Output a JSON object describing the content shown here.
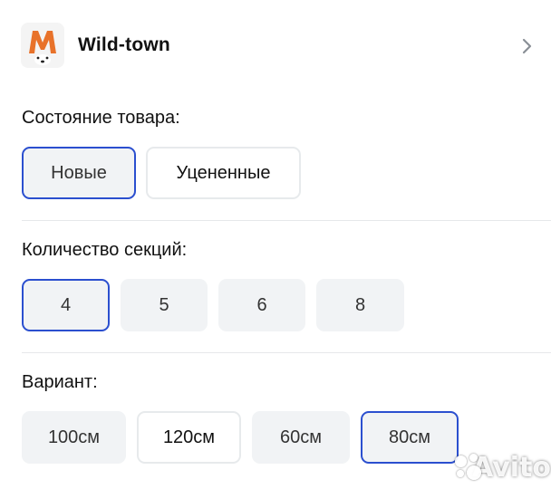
{
  "seller": {
    "logo_letter": "M",
    "name": "Wild-town",
    "logo_icon": "shop-logo-icon",
    "chevron_icon": "chevron-right-icon",
    "accent": "#e8722a"
  },
  "condition": {
    "title": "Состояние товара:",
    "options": [
      "Новые",
      "Уцененные"
    ],
    "selected": "Новые"
  },
  "sections": {
    "title": "Количество секций:",
    "options": [
      "4",
      "5",
      "6",
      "8"
    ],
    "selected": "4"
  },
  "variant": {
    "title": "Вариант:",
    "options": [
      "100см",
      "120см",
      "60см",
      "80см"
    ],
    "selected": "80см"
  },
  "watermark": {
    "text": "Avito"
  },
  "colors": {
    "selected_border": "#2b4fcf",
    "option_bg": "#f1f3f5",
    "divider": "#e6e8ea"
  }
}
